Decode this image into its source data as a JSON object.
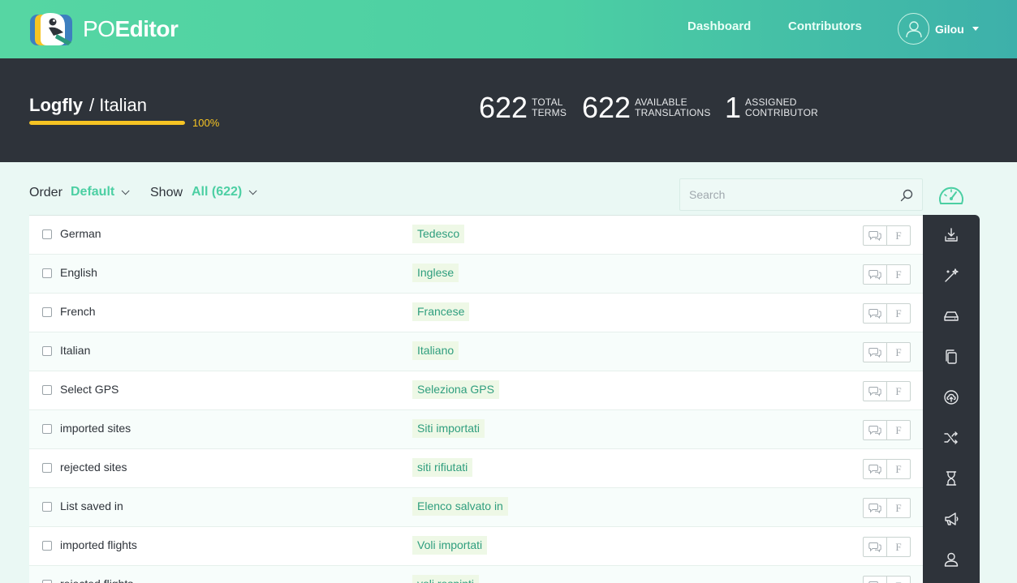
{
  "app": {
    "logo_prefix": "PO",
    "logo_suffix": "Editor"
  },
  "nav": {
    "dashboard": "Dashboard",
    "contributors": "Contributors",
    "user_name": "Gilou"
  },
  "project": {
    "name": "Logfly",
    "language": "/ Italian",
    "progress_percent": 100,
    "progress_label": "100%"
  },
  "stats": {
    "total_terms": {
      "value": "622",
      "label_line1": "TOTAL",
      "label_line2": "TERMS"
    },
    "available_translations": {
      "value": "622",
      "label_line1": "AVAILABLE",
      "label_line2": "TRANSLATIONS"
    },
    "assigned_contributor": {
      "value": "1",
      "label_line1": "ASSIGNED",
      "label_line2": "CONTRIBUTOR"
    }
  },
  "toolbar": {
    "order_label": "Order",
    "order_value": "Default",
    "show_label": "Show",
    "show_value": "All (622)",
    "search_placeholder": "Search"
  },
  "rows": [
    {
      "term": "German",
      "translation": "Tedesco"
    },
    {
      "term": "English",
      "translation": "Inglese"
    },
    {
      "term": "French",
      "translation": "Francese"
    },
    {
      "term": "Italian",
      "translation": "Italiano"
    },
    {
      "term": "Select GPS",
      "translation": "Seleziona GPS"
    },
    {
      "term": "imported sites",
      "translation": "Siti importati"
    },
    {
      "term": "rejected sites",
      "translation": "siti rifiutati"
    },
    {
      "term": "List saved in",
      "translation": "Elenco salvato in"
    },
    {
      "term": "imported flights",
      "translation": "Voli importati"
    },
    {
      "term": "rejected flights",
      "translation": "voli respinti"
    }
  ],
  "row_button_f": "F",
  "sidebar_icons": [
    "download-icon",
    "magic-wand-icon",
    "drive-icon",
    "copy-icon",
    "upload-cloud-icon",
    "shuffle-icon",
    "hourglass-icon",
    "megaphone-icon",
    "user-icon"
  ],
  "colors": {
    "accent": "#4ccfa3",
    "dark": "#2e333a",
    "progress": "#f6c423",
    "translation_bg": "#eef8e6"
  }
}
